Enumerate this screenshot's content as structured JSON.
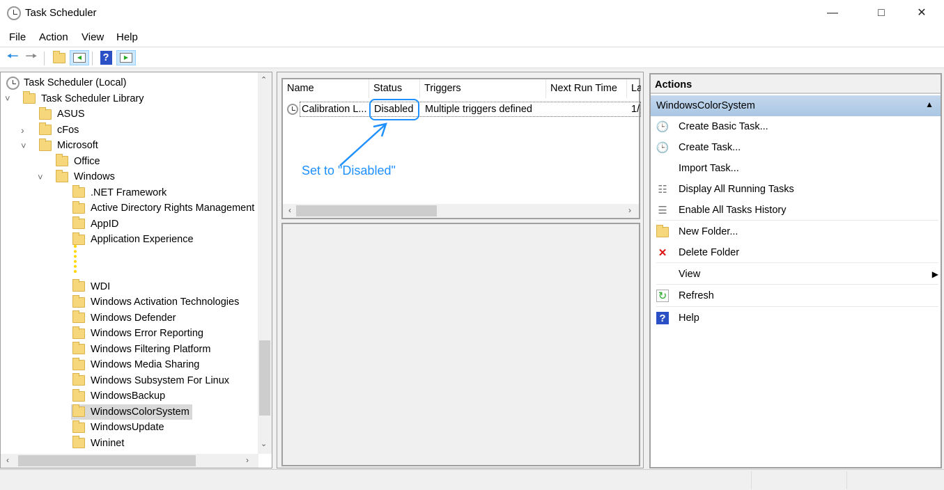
{
  "window": {
    "title": "Task Scheduler"
  },
  "menu": [
    "File",
    "Action",
    "View",
    "Help"
  ],
  "toolbar": {
    "icons": [
      "back-arrow-icon",
      "forward-arrow-icon",
      "up-folder-icon",
      "show-hide-console-tree-icon",
      "help-icon",
      "show-hide-action-pane-icon"
    ]
  },
  "tree": {
    "items": [
      {
        "label": "Task Scheduler (Local)",
        "level": 0,
        "icon": "clock",
        "exp": ""
      },
      {
        "label": "Task Scheduler Library",
        "level": 1,
        "icon": "clock-folder",
        "exp": "open"
      },
      {
        "label": "ASUS",
        "level": 2,
        "icon": "folder",
        "exp": ""
      },
      {
        "label": "cFos",
        "level": 2,
        "icon": "folder",
        "exp": "closed"
      },
      {
        "label": "Microsoft",
        "level": 2,
        "icon": "folder",
        "exp": "open"
      },
      {
        "label": "Office",
        "level": 3,
        "icon": "folder",
        "exp": ""
      },
      {
        "label": "Windows",
        "level": 3,
        "icon": "folder",
        "exp": "open"
      },
      {
        "label": ".NET Framework",
        "level": 4,
        "icon": "folder",
        "exp": ""
      },
      {
        "label": "Active Directory Rights Management",
        "level": 4,
        "icon": "folder",
        "exp": ""
      },
      {
        "label": "AppID",
        "level": 4,
        "icon": "folder",
        "exp": ""
      },
      {
        "label": "Application Experience",
        "level": 4,
        "icon": "folder",
        "exp": ""
      },
      {
        "label": "",
        "level": 4,
        "icon": "gap",
        "exp": ""
      },
      {
        "label": "",
        "level": 4,
        "icon": "gap",
        "exp": ""
      },
      {
        "label": "WDI",
        "level": 4,
        "icon": "folder",
        "exp": ""
      },
      {
        "label": "Windows Activation Technologies",
        "level": 4,
        "icon": "folder",
        "exp": ""
      },
      {
        "label": "Windows Defender",
        "level": 4,
        "icon": "folder",
        "exp": ""
      },
      {
        "label": "Windows Error Reporting",
        "level": 4,
        "icon": "folder",
        "exp": ""
      },
      {
        "label": "Windows Filtering Platform",
        "level": 4,
        "icon": "folder",
        "exp": ""
      },
      {
        "label": "Windows Media Sharing",
        "level": 4,
        "icon": "folder",
        "exp": ""
      },
      {
        "label": "Windows Subsystem For Linux",
        "level": 4,
        "icon": "folder",
        "exp": ""
      },
      {
        "label": "WindowsBackup",
        "level": 4,
        "icon": "folder",
        "exp": ""
      },
      {
        "label": "WindowsColorSystem",
        "level": 4,
        "icon": "folder",
        "exp": "",
        "selected": true
      },
      {
        "label": "WindowsUpdate",
        "level": 4,
        "icon": "folder",
        "exp": ""
      },
      {
        "label": "Wininet",
        "level": 4,
        "icon": "folder",
        "exp": ""
      }
    ]
  },
  "tasks": {
    "columns": [
      "Name",
      "Status",
      "Triggers",
      "Next Run Time",
      "La"
    ],
    "rows": [
      {
        "name": "Calibration L...",
        "status": "Disabled",
        "triggers": "Multiple triggers defined",
        "next_run": "",
        "last": "1/"
      }
    ],
    "annotation": "Set to \"Disabled\"",
    "annotation_color": "#1e90ff"
  },
  "actions": {
    "header": "Actions",
    "section": "WindowsColorSystem",
    "items": [
      {
        "label": "Create Basic Task...",
        "icon": "create-basic-task-icon"
      },
      {
        "label": "Create Task...",
        "icon": "create-task-icon"
      },
      {
        "label": "Import Task...",
        "icon": ""
      },
      {
        "label": "Display All Running Tasks",
        "icon": "running-tasks-icon"
      },
      {
        "label": "Enable All Tasks History",
        "icon": "history-icon"
      },
      {
        "label": "New Folder...",
        "icon": "new-folder-icon"
      },
      {
        "label": "Delete Folder",
        "icon": "delete-icon"
      },
      {
        "label": "View",
        "icon": "",
        "submenu": true
      },
      {
        "label": "Refresh",
        "icon": "refresh-icon"
      },
      {
        "label": "Help",
        "icon": "help-icon"
      }
    ]
  }
}
